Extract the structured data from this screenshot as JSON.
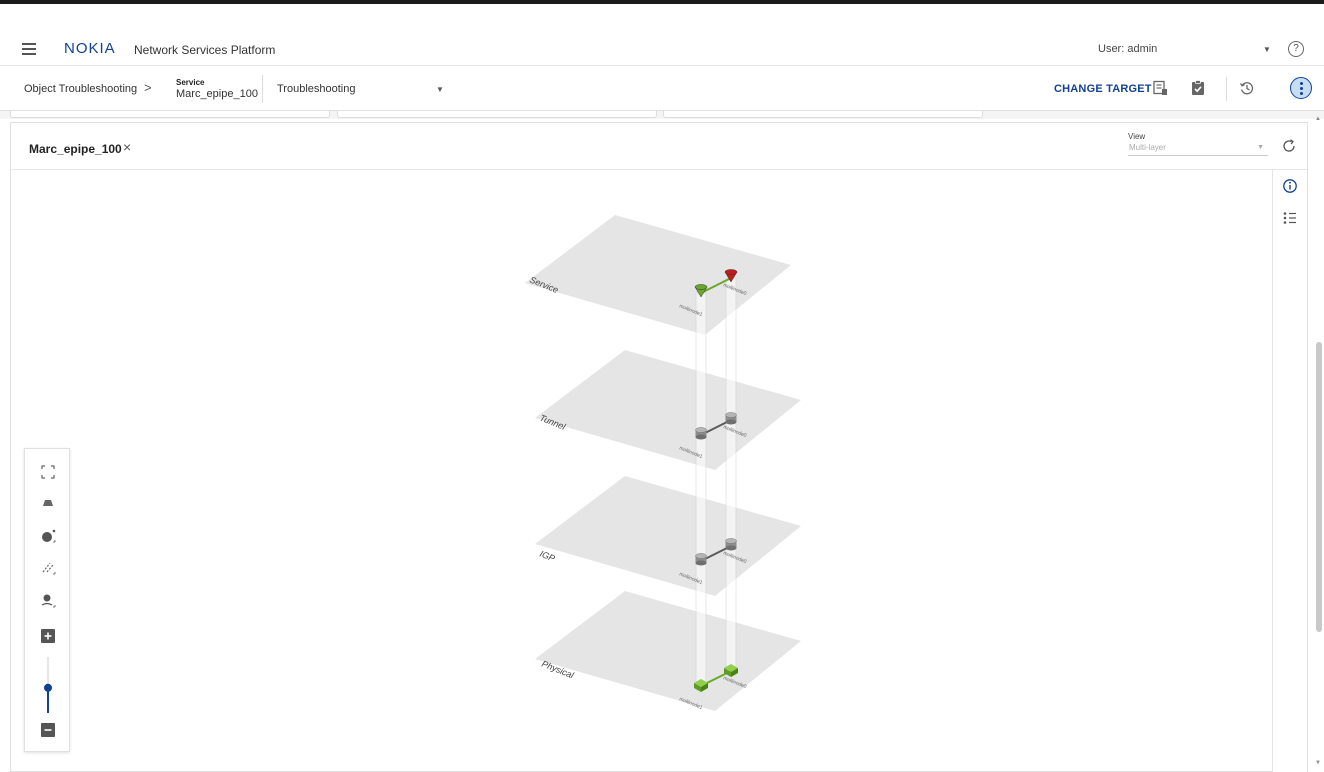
{
  "appbar": {
    "logo": "NOKIA",
    "title": "Network Services Platform",
    "user": "User: admin",
    "help": "?"
  },
  "toolbar": {
    "crumb_root": "Object Troubleshooting",
    "crumb_separator": ">",
    "service_type": "Service",
    "service_name": "Marc_epipe_100",
    "mode": "Troubleshooting",
    "change_target": "CHANGE TARGET"
  },
  "panel": {
    "tab_title": "Marc_epipe_100",
    "close_glyph": "×",
    "view_label": "View",
    "view_value": "Multi-layer"
  },
  "layers": [
    {
      "label": "Service",
      "node_type": "service",
      "node_a": "multinode1",
      "node_b": "multinode0",
      "node_a_status": "green",
      "node_b_status": "red"
    },
    {
      "label": "Tunnel",
      "node_type": "router",
      "node_a": "multinode1",
      "node_b": "multinode0"
    },
    {
      "label": "IGP",
      "node_type": "router",
      "node_a": "multinode1",
      "node_b": "multinode0"
    },
    {
      "label": "Physical",
      "node_type": "switch",
      "node_a": "multinode1",
      "node_b": "multinode0"
    }
  ],
  "colors": {
    "brand": "#124191",
    "plane": "#e5e5e5",
    "status_up": "#6aa82a",
    "status_down": "#c41a1a",
    "router": "#8c8c8c"
  },
  "zoom_controls": {
    "level": 0.45,
    "icons": [
      "fit-screen-icon",
      "perspective-icon",
      "node-size-icon",
      "link-style-icon",
      "label-pin-icon",
      "zoom-in-icon",
      "zoom-out-icon"
    ]
  }
}
